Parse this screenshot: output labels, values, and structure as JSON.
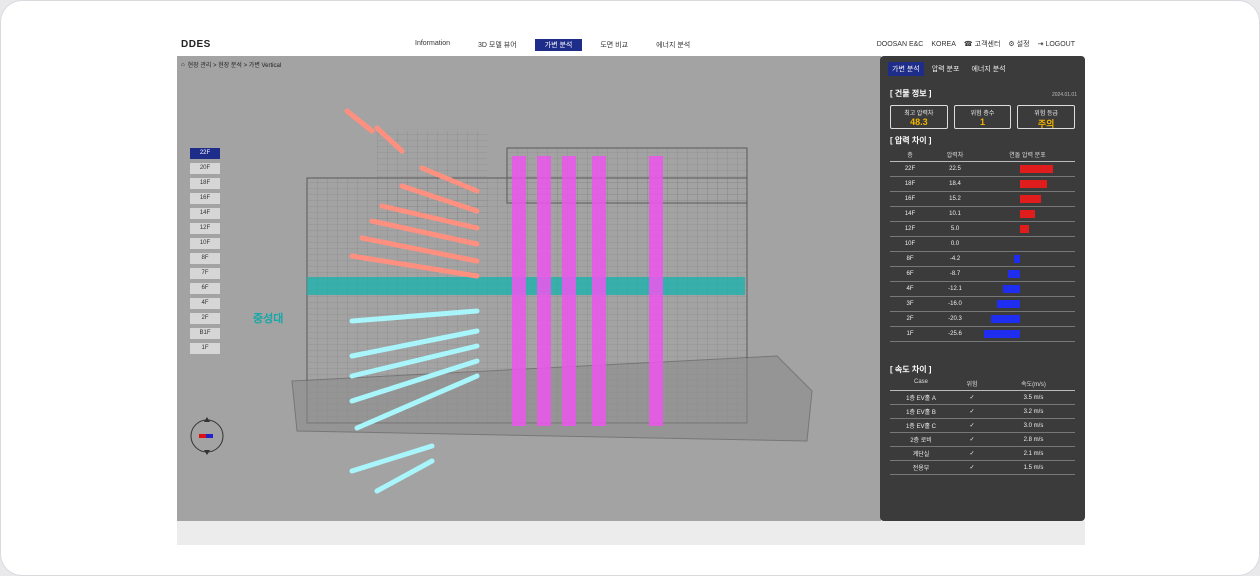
{
  "app": {
    "logo": "DDES"
  },
  "nav": {
    "tabs": [
      "Information",
      "3D 모델 뷰어",
      "가변 분석",
      "도면 비교",
      "에너지 분석"
    ],
    "active_index": 2
  },
  "utility": {
    "items": [
      "DOOSAN E&C",
      "KOREA",
      "고객센터",
      "설정",
      "LOGOUT"
    ]
  },
  "breadcrumb": {
    "text": "현장 관리 > 현장 분석 > 가변 Vertical"
  },
  "floors": {
    "items": [
      "22F",
      "20F",
      "18F",
      "16F",
      "14F",
      "12F",
      "10F",
      "8F",
      "7F",
      "6F",
      "4F",
      "2F",
      "B1F",
      "1F"
    ],
    "active_index": 0
  },
  "viewport": {
    "neutral_label": "중성대"
  },
  "panel": {
    "tabs": [
      "가변 분석",
      "압력 분포",
      "에너지 분석"
    ],
    "active_tab": 0,
    "section1": {
      "title": "[ 건물 정보 ]",
      "subtitle": "2024.01.01"
    },
    "kpis": [
      {
        "label": "최고 압력차",
        "value": "48.3"
      },
      {
        "label": "위험 층수",
        "value": "1"
      },
      {
        "label": "위험 등급",
        "value": "주의"
      }
    ],
    "section2": {
      "title": "[ 압력 차이 ]",
      "col1": "층",
      "col2": "압력차",
      "col3": "연돌 압력 분포"
    },
    "pressure_rows": [
      {
        "floor": "22F",
        "value": "22.5",
        "bar": 0.55,
        "color": "#e01c1c"
      },
      {
        "floor": "18F",
        "value": "18.4",
        "bar": 0.45,
        "color": "#e01c1c"
      },
      {
        "floor": "16F",
        "value": "15.2",
        "bar": 0.35,
        "color": "#e01c1c"
      },
      {
        "floor": "14F",
        "value": "10.1",
        "bar": 0.25,
        "color": "#e01c1c"
      },
      {
        "floor": "12F",
        "value": "5.0",
        "bar": 0.15,
        "color": "#e01c1c"
      },
      {
        "floor": "10F",
        "value": "0.0",
        "bar": 0.0,
        "color": "#e01c1c"
      },
      {
        "floor": "8F",
        "value": "-4.2",
        "bar": 0.1,
        "color": "#1f2df0"
      },
      {
        "floor": "6F",
        "value": "-8.7",
        "bar": 0.2,
        "color": "#1f2df0"
      },
      {
        "floor": "4F",
        "value": "-12.1",
        "bar": 0.28,
        "color": "#1f2df0"
      },
      {
        "floor": "3F",
        "value": "-16.0",
        "bar": 0.38,
        "color": "#1f2df0"
      },
      {
        "floor": "2F",
        "value": "-20.3",
        "bar": 0.48,
        "color": "#1f2df0"
      },
      {
        "floor": "1F",
        "value": "-25.6",
        "bar": 0.6,
        "color": "#1f2df0"
      }
    ],
    "section3": {
      "title": "[ 속도 차이 ]"
    },
    "velocity_headers": [
      "Case",
      "위험",
      "속도(m/s)"
    ],
    "velocity_rows": [
      {
        "case": "1층 EV홀 A",
        "flag": "✓",
        "value": "3.5 m/s"
      },
      {
        "case": "1층 EV홀 B",
        "flag": "✓",
        "value": "3.2 m/s"
      },
      {
        "case": "1층 EV홀 C",
        "flag": "✓",
        "value": "3.0 m/s"
      },
      {
        "case": "2층 로비",
        "flag": "✓",
        "value": "2.8 m/s"
      },
      {
        "case": "계단실",
        "flag": "✓",
        "value": "2.1 m/s"
      },
      {
        "case": "전용부",
        "flag": "✓",
        "value": "1.5 m/s"
      }
    ]
  }
}
